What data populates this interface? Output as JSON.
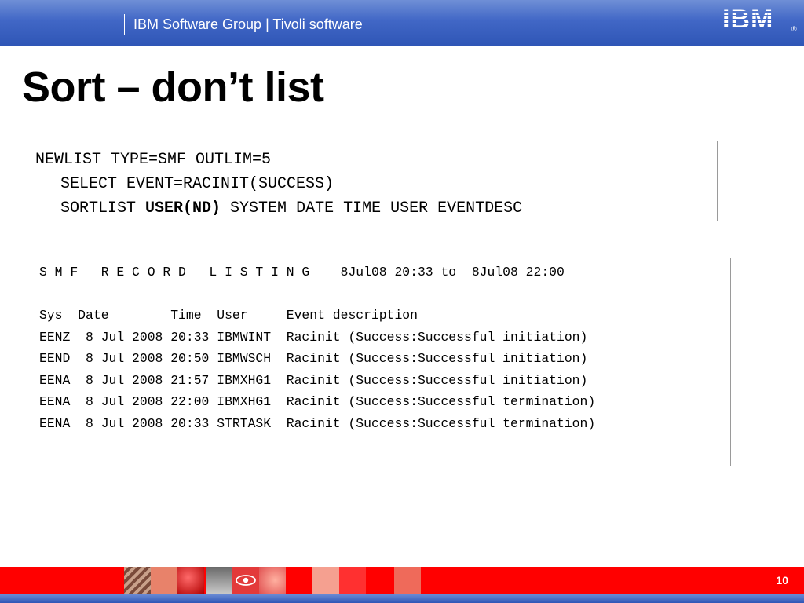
{
  "header": {
    "title": "IBM Software Group | Tivoli software",
    "logo_text": "IBM",
    "logo_mark": "®"
  },
  "slide": {
    "title": "Sort – don’t list",
    "page_number": "10"
  },
  "command": {
    "line1": "NEWLIST TYPE=SMF OUTLIM=5",
    "line2": "SELECT EVENT=RACINIT(SUCCESS)",
    "line3_prefix": "SORTLIST ",
    "line3_bold": "USER(ND)",
    "line3_suffix": " SYSTEM DATE TIME USER EVENTDESC"
  },
  "listing": {
    "heading": "S M F   R E C O R D   L I S T I N G    8Jul08 20:33 to  8Jul08 22:00",
    "columns_line": "Sys  Date        Time  User     Event description",
    "rows": [
      "EENZ  8 Jul 2008 20:33 IBMWINT  Racinit (Success:Successful initiation)",
      "EEND  8 Jul 2008 20:50 IBMWSCH  Racinit (Success:Successful initiation)",
      "EENA  8 Jul 2008 21:57 IBMXHG1  Racinit (Success:Successful initiation)",
      "EENA  8 Jul 2008 22:00 IBMXHG1  Racinit (Success:Successful termination)",
      "EENA  8 Jul 2008 20:33 STRTASK  Racinit (Success:Successful termination)"
    ]
  },
  "colors": {
    "header_blue": "#4167c6",
    "footer_red": "#ff0000",
    "text": "#000000"
  }
}
